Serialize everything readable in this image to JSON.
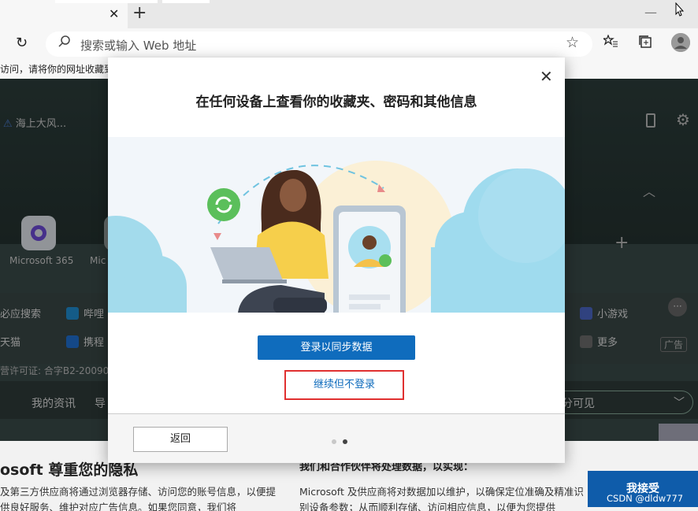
{
  "browser": {
    "tab_close": "✕",
    "new_tab": "+",
    "minimize": "—",
    "refresh_icon": "↻",
    "address_placeholder": "搜索或输入 Web 地址",
    "favorites_notice": "访问，请将你的网址收藏到"
  },
  "page": {
    "weather": "海上大风...",
    "apps": [
      "Microsoft 365",
      "Mic"
    ],
    "links": [
      {
        "label": "必应搜索",
        "color": "#2a6fd6"
      },
      {
        "label": "哔哩",
        "color": "#1f8ccf"
      },
      {
        "label": "小游戏",
        "color": "#4a66c4"
      },
      {
        "label": "天猫",
        "color": "#c43a2f"
      },
      {
        "label": "携程",
        "color": "#1f6fd0"
      },
      {
        "label": "更多",
        "color": "#6c6c6c"
      }
    ],
    "more_dots": "···",
    "ad_label": "广告",
    "license": "营许可证: 合字B2-20090",
    "news_tabs": [
      "我的资讯",
      "导"
    ],
    "visibility_select": "分可见"
  },
  "privacy": {
    "title": "osoft 尊重您的隐私",
    "text": "及第三方供应商将通过浏览器存储、访问您的账号信息，以便提供良好服务、维护对应广告信息。如果您同意，我们将",
    "title2": "我们和合作伙伴将处理数据，以实现：",
    "text2": "Microsoft 及供应商将对数据加以维护，以确保定位准确及精准识别设备参数；从而顺利存储、访问相应信息，以便为您提供",
    "accept_label": "我接受",
    "watermark": "CSDN @dldw777"
  },
  "dialog": {
    "title": "在任何设备上查看你的收藏夹、密码和其他信息",
    "signin_label": "登录以同步数据",
    "continue_label": "继续但不登录",
    "back_label": "返回",
    "close_icon": "✕",
    "page_dots": 2,
    "active_dot": 2,
    "accent": "#0f6cbd",
    "highlight": "#e03030"
  }
}
